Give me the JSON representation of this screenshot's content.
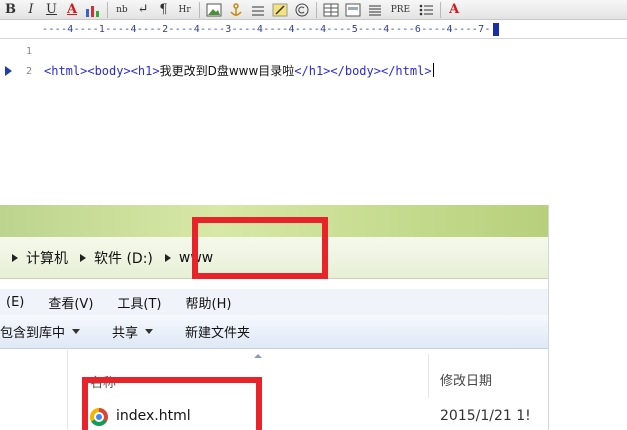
{
  "editor": {
    "toolbar": {
      "buttons": [
        {
          "name": "bold-button",
          "glyph": "B"
        },
        {
          "name": "italic-button",
          "glyph": "I"
        },
        {
          "name": "underline-button",
          "glyph": "U"
        },
        {
          "name": "font-color-button",
          "glyph": "A"
        },
        {
          "name": "html-button",
          "glyph": "nb"
        },
        {
          "name": "break-button",
          "glyph": "↵"
        },
        {
          "name": "paragraph-button",
          "glyph": "¶"
        },
        {
          "name": "hr-button",
          "glyph": "Hr"
        },
        {
          "name": "list-button",
          "glyph": "PRE"
        },
        {
          "name": "anchor-button",
          "glyph": "A"
        }
      ]
    },
    "ruler": "----4----1----4----2----4----3----4----4----4----5----4----6----4----7-",
    "line_numbers": [
      "1",
      "2"
    ],
    "code": {
      "line2_open": "<html><body><h1>",
      "line2_text": "我更改到D盘www目录啦",
      "line2_close": "</h1></body></html>"
    }
  },
  "explorer": {
    "breadcrumbs": [
      "计算机",
      "软件 (D:)",
      "www"
    ],
    "menus": [
      "(E)",
      "查看(V)",
      "工具(T)",
      "帮助(H)"
    ],
    "commands": [
      {
        "label": "包含到库中",
        "has_dropdown": true
      },
      {
        "label": "共享",
        "has_dropdown": true
      },
      {
        "label": "新建文件夹",
        "has_dropdown": false
      }
    ],
    "columns": {
      "name": "名称",
      "date": "修改日期"
    },
    "files": [
      {
        "name": "index.html",
        "date": "2015/1/21 1!",
        "icon": "chrome-icon"
      }
    ]
  },
  "colors": {
    "highlight": "#e8242a",
    "code_tag": "#2a2ae0",
    "ruler": "#2f3f9c"
  }
}
